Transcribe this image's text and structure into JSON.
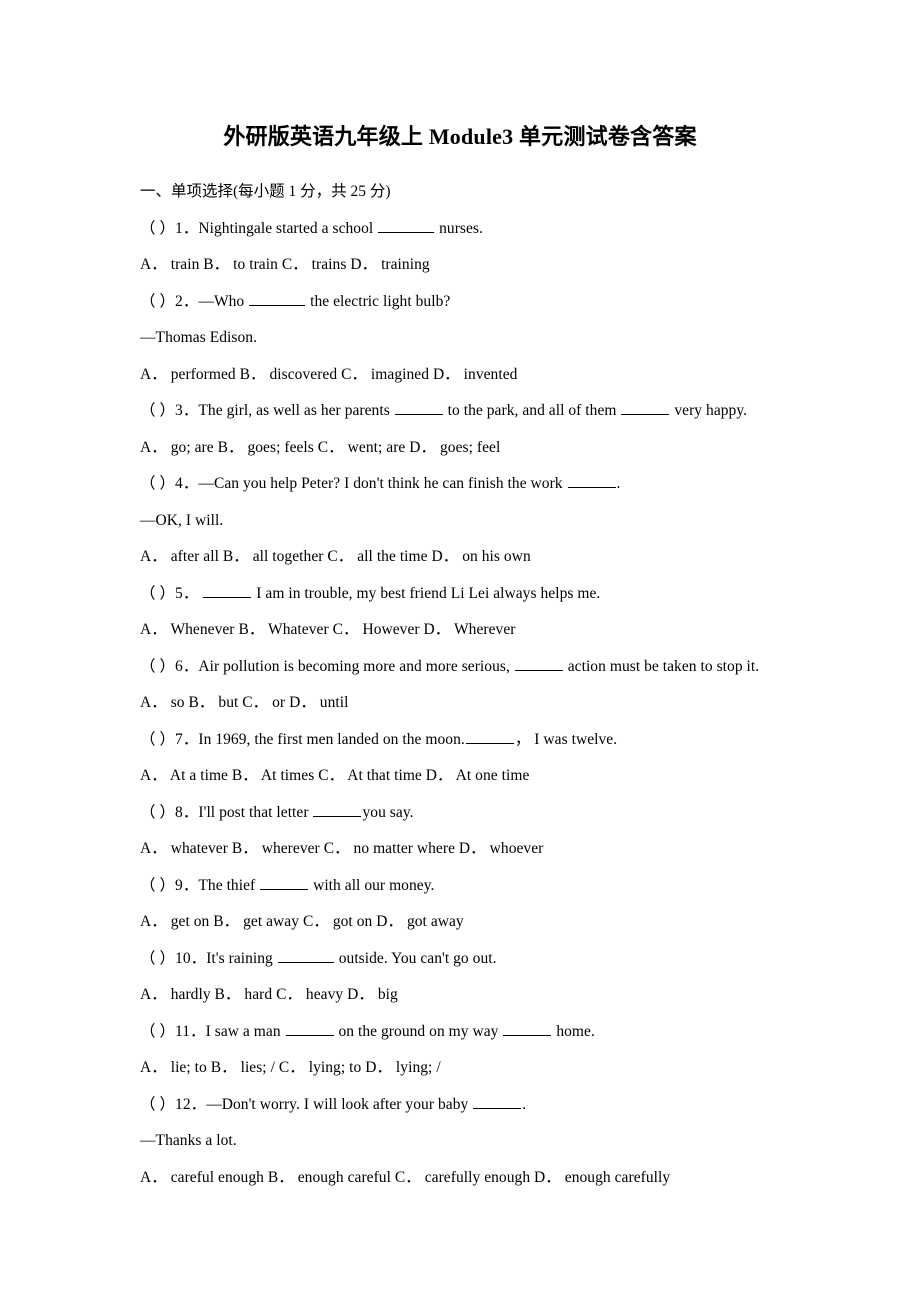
{
  "document": {
    "title": "外研版英语九年级上 Module3 单元测试卷含答案",
    "section_heading": "一、单项选择(每小题 1 分，共 25 分)"
  },
  "questions": [
    {
      "number": "1",
      "stem_prefix": "（  ）1．",
      "stem_before": "Nightingale started a school ",
      "stem_after": " nurses.",
      "options_line": "A．  train      B．  to train      C．  trains      D．  training"
    },
    {
      "number": "2",
      "stem_prefix": "（  ）2．",
      "stem_before": "—Who ",
      "stem_after": " the electric light bulb?",
      "reply": "—Thomas Edison.",
      "options_line": "A．  performed      B．  discovered  C．  imagined      D．  invented"
    },
    {
      "number": "3",
      "stem_prefix": "（  ）3．",
      "stem_before": "The girl, as well as her parents ",
      "stem_middle": " to the park, and all of them ",
      "stem_after": " very happy.",
      "options_line": "A．  go; are      B．  goes; feels  C．  went; are      D．  goes; feel"
    },
    {
      "number": "4",
      "stem_prefix": "（  ）4．",
      "stem_before": "—Can you help Peter? I don't think he can finish the work ",
      "stem_after": ".",
      "reply": "—OK, I will.",
      "options_line": "A．  after all      B．  all together  C．  all the time      D．  on his own"
    },
    {
      "number": "5",
      "stem_prefix": "（  ）5．",
      "stem_before": " ",
      "stem_after": " I am in trouble, my best friend Li Lei always helps me.",
      "options_line": "A．  Whenever      B．  Whatever  C．  However      D．  Wherever"
    },
    {
      "number": "6",
      "stem_prefix": "（  ）6．",
      "stem_before": "Air pollution is becoming more and more serious, ",
      "stem_after": " action must be taken to stop it.",
      "options_line": "A．  so      B．  but      C．  or      D．  until"
    },
    {
      "number": "7",
      "stem_prefix": "（  ）7．",
      "stem_before": "In 1969, the first men landed on the moon.",
      "stem_after": "，   I was twelve.",
      "options_line": "A．  At a time      B．  At times  C．  At that time      D．  At one time"
    },
    {
      "number": "8",
      "stem_prefix": "（  ）8．",
      "stem_before": "I'll post that letter ",
      "stem_after": "you say.",
      "options_line": "A．  whatever      B．  wherever      C．  no matter where      D．  whoever"
    },
    {
      "number": "9",
      "stem_prefix": "（  ）9．",
      "stem_before": "The thief ",
      "stem_after": " with all our money.",
      "options_line": "A．  get on      B．  get away  C．  got on      D．  got away"
    },
    {
      "number": "10",
      "stem_prefix": "（  ）10．",
      "stem_before": "It's raining ",
      "stem_after": " outside. You can't go out.",
      "options_line": "A．  hardly      B．  hard      C．  heavy      D．  big"
    },
    {
      "number": "11",
      "stem_prefix": "（  ）11．",
      "stem_before": "I saw a man ",
      "stem_middle": " on the ground on my way ",
      "stem_after": " home.",
      "options_line": "A．  lie; to      B．  lies; /      C．  lying; to      D．  lying; /"
    },
    {
      "number": "12",
      "stem_prefix": "（  ）12．",
      "stem_before": "—Don't worry. I will look after your baby ",
      "stem_after": ".",
      "reply": "—Thanks a lot.",
      "options_line": "A．  careful enough      B．  enough careful  C．  carefully enough      D．  enough carefully"
    }
  ]
}
